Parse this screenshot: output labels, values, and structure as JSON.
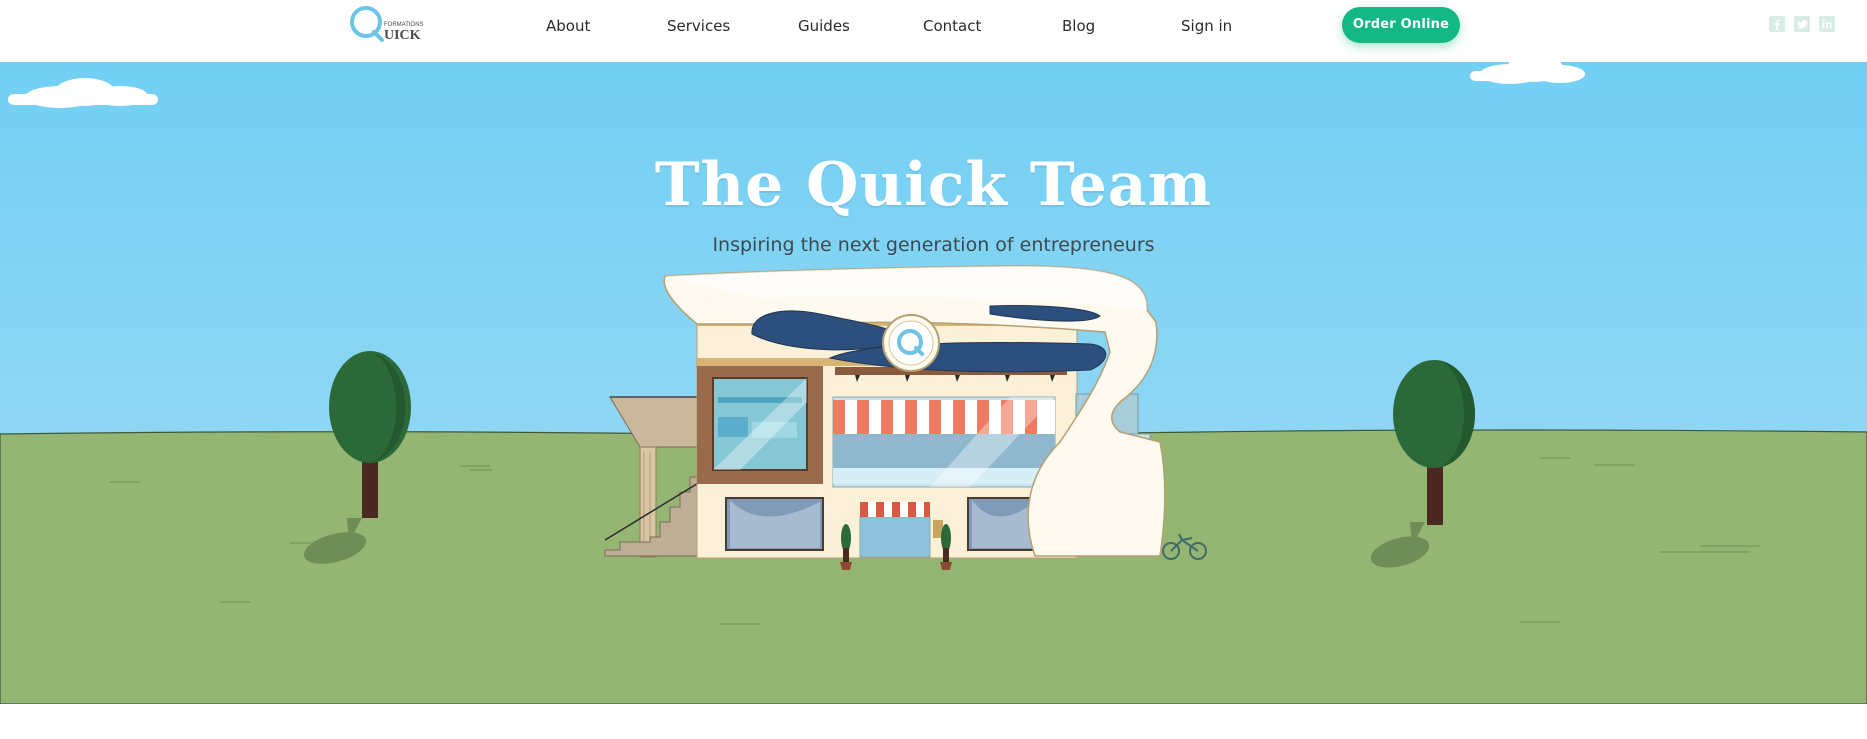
{
  "header": {
    "logo": {
      "small_text": "FORMATIONS",
      "big_text": "UICK"
    },
    "nav": [
      {
        "label": "About"
      },
      {
        "label": "Services"
      },
      {
        "label": "Guides"
      },
      {
        "label": "Contact"
      },
      {
        "label": "Blog"
      },
      {
        "label": "Sign in"
      }
    ],
    "order_button": "Order Online",
    "social_icons": [
      "facebook-icon",
      "twitter-icon",
      "linkedin-icon"
    ]
  },
  "hero": {
    "title": "The Quick Team",
    "subtitle": "Inspiring the next generation of entrepreneurs"
  },
  "colors": {
    "accent": "#14b885",
    "sky_top": "#72cff4",
    "sky_bottom": "#a4dcf4",
    "grass": "#95b573",
    "tree": "#2b6a38"
  }
}
